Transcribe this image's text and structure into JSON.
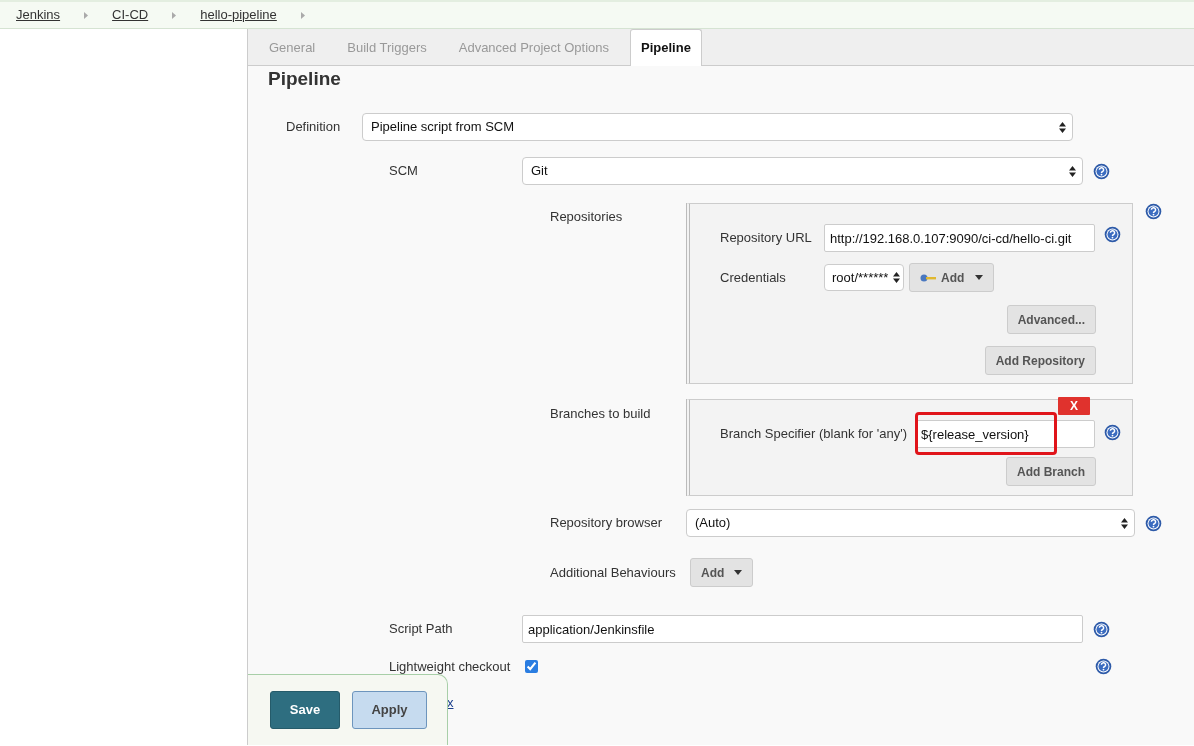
{
  "breadcrumbs": [
    "Jenkins",
    "CI-CD",
    "hello-pipeline"
  ],
  "tabs": [
    {
      "label": "General",
      "selected": false
    },
    {
      "label": "Build Triggers",
      "selected": false
    },
    {
      "label": "Advanced Project Options",
      "selected": false
    },
    {
      "label": "Pipeline",
      "selected": true
    }
  ],
  "section_title": "Pipeline",
  "definition": {
    "label": "Definition",
    "value": "Pipeline script from SCM"
  },
  "scm": {
    "label": "SCM",
    "value": "Git"
  },
  "repositories": {
    "label": "Repositories",
    "url": {
      "label": "Repository URL",
      "value": "http://192.168.0.107:9090/ci-cd/hello-ci.git"
    },
    "credentials": {
      "label": "Credentials",
      "value": "root/******",
      "add_button": "Add"
    },
    "buttons": [
      "Advanced...",
      "Add Repository"
    ]
  },
  "branches": {
    "label": "Branches to build",
    "delete_button": "X",
    "specifier": {
      "label": "Branch Specifier (blank for 'any')",
      "value": "${release_version}",
      "highlighted": true
    },
    "add_button": "Add Branch"
  },
  "repository_browser": {
    "label": "Repository browser",
    "value": "(Auto)"
  },
  "additional_behaviours": {
    "label": "Additional Behaviours",
    "button": "Add"
  },
  "script_path": {
    "label": "Script Path",
    "value": "application/Jenkinsfile"
  },
  "lightweight_checkout": {
    "label": "Lightweight checkout",
    "checked": true
  },
  "pipeline_syntax_link": "x",
  "buttons": [
    {
      "label": "Save",
      "kind": "primary"
    },
    {
      "label": "Apply",
      "kind": "secondary"
    }
  ]
}
